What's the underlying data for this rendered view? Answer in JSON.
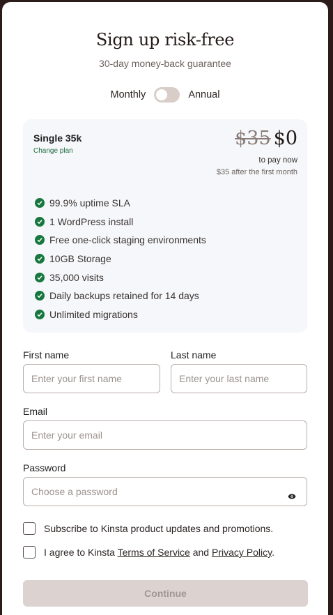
{
  "header": {
    "title": "Sign up risk-free",
    "subtitle": "30-day money-back guarantee"
  },
  "billing": {
    "monthly_label": "Monthly",
    "annual_label": "Annual",
    "toggle_state": "monthly"
  },
  "plan": {
    "name": "Single 35k",
    "change_plan": "Change plan",
    "old_price": "$35",
    "new_price": "$0",
    "pay_now": "to pay now",
    "after_note": "$35 after the first month",
    "features": [
      "99.9% uptime SLA",
      "1 WordPress install",
      "Free one-click staging environments",
      "10GB Storage",
      "35,000 visits",
      "Daily backups retained for 14 days",
      "Unlimited migrations"
    ]
  },
  "form": {
    "first_name": {
      "label": "First name",
      "placeholder": "Enter your first name",
      "value": ""
    },
    "last_name": {
      "label": "Last name",
      "placeholder": "Enter your last name",
      "value": ""
    },
    "email": {
      "label": "Email",
      "placeholder": "Enter your email",
      "value": ""
    },
    "password": {
      "label": "Password",
      "placeholder": "Choose a password",
      "value": "",
      "icon": "eye-icon"
    },
    "subscribe": {
      "label": "Subscribe to Kinsta product updates and promotions.",
      "checked": false
    },
    "agree": {
      "prefix": "I agree to Kinsta ",
      "terms": "Terms of Service",
      "and": " and ",
      "privacy": "Privacy Policy",
      "suffix": ".",
      "checked": false
    },
    "continue_label": "Continue"
  },
  "colors": {
    "accent_green": "#17783f",
    "background_dark": "#2b1c1a",
    "panel": "#f5f7fa",
    "button_disabled": "#dcd3d0"
  }
}
